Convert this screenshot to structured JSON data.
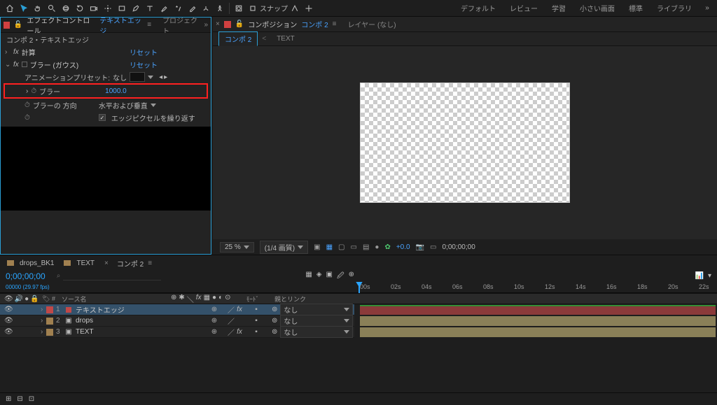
{
  "toolbar": {
    "snap_label": "スナップ",
    "workspaces": [
      "デフォルト",
      "レビュー",
      "学習",
      "小さい画面",
      "標準",
      "ライブラリ"
    ]
  },
  "ec_panel": {
    "tab_prefix": "エフェクトコントロール",
    "tab_layer": "テキストエッジ",
    "inactive_tab": "プロジェクト",
    "breadcrumb": "コンポ 2・テキストエッジ",
    "fx1_name": "計算",
    "fx1_reset": "リセット",
    "fx2_name": "ブラー (ガウス)",
    "fx2_reset": "リセット",
    "preset_label": "アニメーションプリセット:",
    "preset_value": "なし",
    "blur_label": "ブラー",
    "blur_value": "1000.0",
    "dir_label": "ブラーの 方向",
    "dir_value": "水平および垂直",
    "repeat_label": "エッジピクセルを繰り返す"
  },
  "viewer": {
    "tab_prefix": "コンポジション",
    "tab_comp": "コンポ 2",
    "inactive_tab": "レイヤー (なし)",
    "sub_active": "コンポ 2",
    "sub_inactive": "TEXT",
    "zoom": "25 %",
    "res": "(1/4 画質)",
    "exposure": "+0.0",
    "timecode": "0;00;00;00"
  },
  "timeline": {
    "tabs": [
      {
        "label": "drops_BK1",
        "folder": true,
        "active": false
      },
      {
        "label": "TEXT",
        "folder": true,
        "active": false
      },
      {
        "label": "コンポ 2",
        "folder": false,
        "active": true
      }
    ],
    "timecode": "0;00;00;00",
    "framerate": "00000 (29.97 fps)",
    "search_placeholder": "",
    "col_source": "ソース名",
    "col_mode": "ﾓｰﾄﾞ",
    "col_parent": "親とリンク",
    "ticks": [
      "00s",
      "02s",
      "04s",
      "06s",
      "08s",
      "10s",
      "12s",
      "14s",
      "16s",
      "18s",
      "20s",
      "22s"
    ],
    "layers": [
      {
        "num": "1",
        "name": "テキストエッジ",
        "color": "#c04848",
        "selected": true,
        "icon": "solid",
        "parent": "なし",
        "fx": true
      },
      {
        "num": "2",
        "name": "drops",
        "color": "#a08050",
        "selected": false,
        "icon": "comp",
        "parent": "なし",
        "fx": false
      },
      {
        "num": "3",
        "name": "TEXT",
        "color": "#a08050",
        "selected": false,
        "icon": "comp",
        "parent": "なし",
        "fx": true
      }
    ],
    "footer_icons": true
  }
}
